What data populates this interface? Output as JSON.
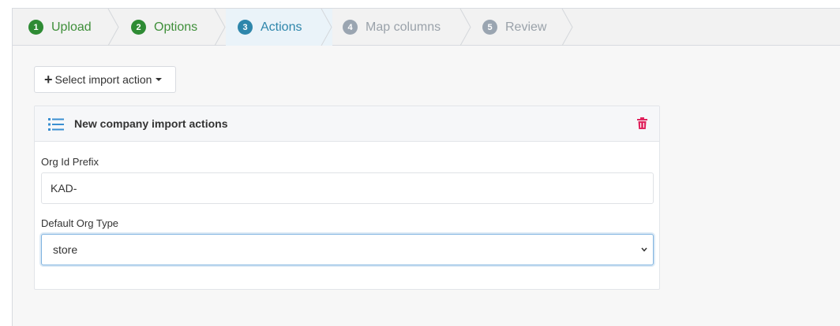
{
  "wizard": {
    "steps": [
      {
        "number": "1",
        "label": "Upload",
        "state": "done"
      },
      {
        "number": "2",
        "label": "Options",
        "state": "done"
      },
      {
        "number": "3",
        "label": "Actions",
        "state": "active"
      },
      {
        "number": "4",
        "label": "Map columns",
        "state": "todo"
      },
      {
        "number": "5",
        "label": "Review",
        "state": "todo"
      }
    ]
  },
  "toolbar": {
    "select_action_label": "Select import action",
    "plus_icon": "+",
    "caret_icon": "caret-down-icon"
  },
  "panel": {
    "title": "New company import actions",
    "icon": "list-icon",
    "delete_icon": "trash-icon",
    "fields": {
      "org_id_prefix": {
        "label": "Org Id Prefix",
        "value": "KAD-"
      },
      "default_org_type": {
        "label": "Default Org Type",
        "value": "store"
      }
    }
  },
  "colors": {
    "done": "#2e8b34",
    "active": "#2e86ab",
    "todo": "#9aa5b1",
    "delete": "#e0245e",
    "list_icon": "#3a8fd1"
  }
}
